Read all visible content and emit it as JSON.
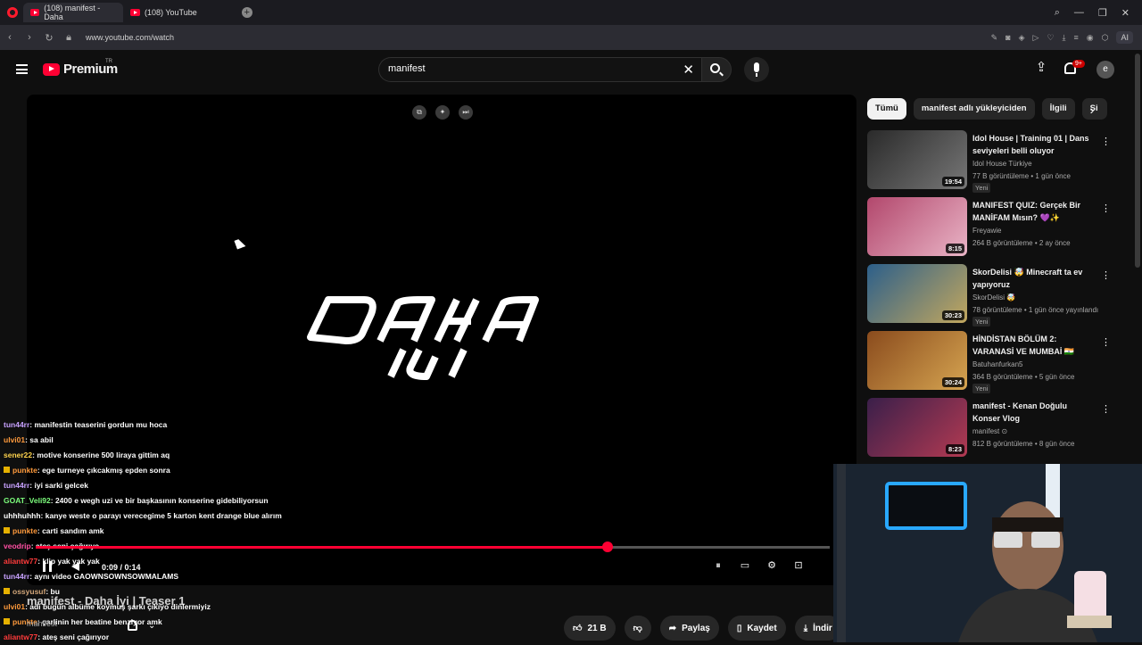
{
  "browser": {
    "tabs": [
      {
        "label": "(108) manifest - Daha"
      },
      {
        "label": "(108) YouTube"
      }
    ],
    "url": "www.youtube.com/watch",
    "ai_label": "AI"
  },
  "masthead": {
    "logo_text": "Premium",
    "country": "TR",
    "search_value": "manifest",
    "notif_count": "9+",
    "avatar_letter": "e"
  },
  "player": {
    "time": "0:09 / 0:14",
    "progress": 0.72,
    "overlay_title": "manifest - Daha İyi | Teaser 1",
    "overlay_channel": "manifest"
  },
  "chat": [
    {
      "user": "tun44rr",
      "color": "#c8a2ff",
      "msg": ": manifestin teaserini gordun mu hoca",
      "sub": false
    },
    {
      "user": "ulvi01",
      "color": "#ff9a3c",
      "msg": ": sa abil",
      "sub": false
    },
    {
      "user": "sener22",
      "color": "#ffd34d",
      "msg": ": motive konserine 500 liraya gittim aq",
      "sub": false
    },
    {
      "user": "punkte",
      "color": "#ff9a3c",
      "msg": ": ege turneye çıkcakmış epden sonra",
      "sub": true
    },
    {
      "user": "tun44rr",
      "color": "#c8a2ff",
      "msg": ": iyi sarki gelcek",
      "sub": false
    },
    {
      "user": "GOAT_Veli92",
      "color": "#7dff7d",
      "msg": ": 2400 e wegh uzi ve bir başkasının konserine gidebiliyorsun",
      "sub": false
    },
    {
      "user": "uhhhuhhh",
      "color": "#ffffff",
      "msg": ": kanye weste o parayı verecegime 5 karton kent drange blue alırım",
      "sub": false
    },
    {
      "user": "punkte",
      "color": "#ff9a3c",
      "msg": ": carti sandım amk",
      "sub": true
    },
    {
      "user": "veodrip",
      "color": "#ff4fa3",
      "msg": ": ateş seni çağırıyo",
      "sub": false
    },
    {
      "user": "aliantw77",
      "color": "#ff3b3b",
      "msg": ": klip yak yak yak",
      "sub": false
    },
    {
      "user": "tun44rr",
      "color": "#c8a2ff",
      "msg": ": aynı video GAOWNSOWNSOWMALAMS",
      "sub": false
    },
    {
      "user": "ossyusuf",
      "color": "#d2a679",
      "msg": ": bu",
      "sub": true
    },
    {
      "user": "ulvi01",
      "color": "#ff9a3c",
      "msg": ": adı bugün albüme koymuş şarkı çıkıyo dinlermiyiz",
      "sub": false
    },
    {
      "user": "punkte",
      "color": "#ff9a3c",
      "msg": ": çarlinin her beatine benziyor amk",
      "sub": true
    },
    {
      "user": "aliantw77",
      "color": "#ff3b3b",
      "msg": ": ateş seni çağırıyor",
      "sub": false
    }
  ],
  "actions": {
    "likes": "21 B",
    "share": "Paylaş",
    "save": "Kaydet",
    "download": "İndir"
  },
  "chips": [
    "Tümü",
    "manifest adlı yükleyiciden",
    "İlgili",
    "Si"
  ],
  "recs": [
    {
      "title": "Idol House | Training 01 | Dans seviyeleri belli oluyor",
      "channel": "Idol House Türkiye",
      "meta": "77 B görüntüleme • 1 gün önce",
      "new": "Yeni",
      "duration": "19:54",
      "c1": "#2a2a2a",
      "c2": "#777"
    },
    {
      "title": "MANIFEST QUIZ: Gerçek Bir MANİFAM Mısın? 💜✨",
      "channel": "Freyawie",
      "meta": "264 B görüntüleme • 2 ay önce",
      "new": "",
      "duration": "8:15",
      "c1": "#b2476c",
      "c2": "#e9b4c6"
    },
    {
      "title": "SkorDelisi 🤯 Minecraft ta ev yapıyoruz",
      "channel": "SkorDelisi 🤯",
      "meta": "78 görüntüleme • 1 gün önce yayınlandı",
      "new": "Yeni",
      "duration": "30:23",
      "c1": "#2c5f8a",
      "c2": "#c2a75e"
    },
    {
      "title": "HİNDİSTAN BÖLÜM 2: VARANASİ VE MUMBAİ 🇮🇳",
      "channel": "Batuhanfurkan5",
      "meta": "364 B görüntüleme • 5 gün önce",
      "new": "Yeni",
      "duration": "30:24",
      "c1": "#8a4b1d",
      "c2": "#d6a551"
    },
    {
      "title": "manifest - Kenan Doğulu Konser Vlog",
      "channel": "manifest ⊙",
      "meta": "812 B görüntüleme • 8 gün önce",
      "new": "",
      "duration": "8:23",
      "c1": "#3a1f4a",
      "c2": "#b33a52"
    }
  ]
}
